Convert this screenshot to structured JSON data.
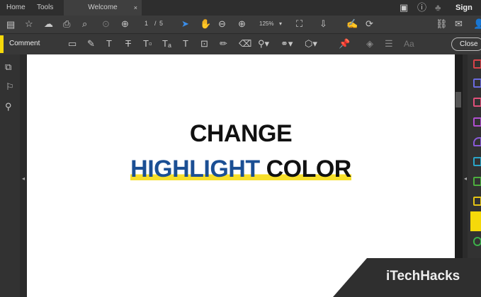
{
  "tabs": {
    "home": "Home",
    "tools": "Tools",
    "welcome": "Welcome",
    "close_tab": "×"
  },
  "header": {
    "sign_in": "Sign In"
  },
  "toolbar": {
    "page_current": "1",
    "page_sep": "/",
    "page_total": "5",
    "zoom": "125%"
  },
  "comment_bar": {
    "label": "Comment",
    "close": "Close",
    "font_label": "Aa"
  },
  "document": {
    "line1": "CHANGE",
    "highlight_word": "HIGHLIGHT",
    "line2_rest": " COLOR"
  },
  "watermark": {
    "logo": "iTechHacks"
  },
  "colors": {
    "highlight_yellow": "#f7df2a",
    "title_blue": "#1b4f94",
    "accent_yellow": "#f5d90a"
  }
}
